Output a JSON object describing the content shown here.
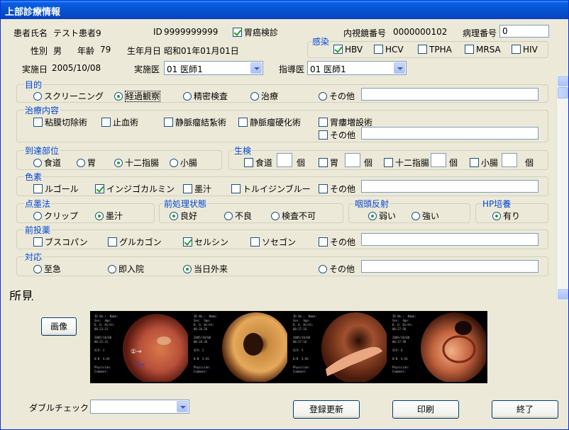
{
  "window": {
    "title": "上部診療情報"
  },
  "header": {
    "patient_name_label": "患者氏名",
    "patient_name": "テスト患者9",
    "id_label": "ID",
    "id_value": "9999999999",
    "gastric_cancer_label": "胃癌検診",
    "gastric_cancer_checked": true,
    "scope_no_label": "内視鏡番号",
    "scope_no": "0000000102",
    "pathology_no_label": "病理番号",
    "pathology_no": "0",
    "sex_label": "性別",
    "sex": "男",
    "age_label": "年齢",
    "age": "79",
    "dob_label": "生年月日",
    "dob": "昭和01年01月01日",
    "date_label": "実施日",
    "date": "2005/10/08",
    "doctor_label": "実施医",
    "doctor": "01 医師1",
    "supervisor_label": "指導医",
    "supervisor": "01 医師1"
  },
  "infection": {
    "title": "感染",
    "items": [
      {
        "label": "HBV",
        "checked": true
      },
      {
        "label": "HCV",
        "checked": false
      },
      {
        "label": "TPHA",
        "checked": false
      },
      {
        "label": "MRSA",
        "checked": false
      },
      {
        "label": "HIV",
        "checked": false
      }
    ]
  },
  "purpose": {
    "title": "目的",
    "options": [
      "スクリーニング",
      "経過観察",
      "精密検査",
      "治療",
      "その他"
    ],
    "selected": "経過観察",
    "other_value": ""
  },
  "treatment": {
    "title": "治療内容",
    "items": [
      {
        "label": "粘膜切除術",
        "checked": false
      },
      {
        "label": "止血術",
        "checked": false
      },
      {
        "label": "静脈瘤結紮術",
        "checked": false
      },
      {
        "label": "静脈瘤硬化術",
        "checked": false
      },
      {
        "label": "胃瘻増設術",
        "checked": false
      },
      {
        "label": "その他",
        "checked": false
      }
    ],
    "other_value": ""
  },
  "reach": {
    "title": "到達部位",
    "options": [
      "食道",
      "胃",
      "十二指腸",
      "小腸"
    ],
    "selected": "十二指腸"
  },
  "biopsy": {
    "title": "生検",
    "unit": "個",
    "items": [
      {
        "label": "食道",
        "checked": false,
        "count": ""
      },
      {
        "label": "胃",
        "checked": false,
        "count": ""
      },
      {
        "label": "十二指腸",
        "checked": false,
        "count": ""
      },
      {
        "label": "小腸",
        "checked": false,
        "count": ""
      }
    ]
  },
  "dye": {
    "title": "色素",
    "items": [
      {
        "label": "ルゴール",
        "checked": false
      },
      {
        "label": "インジゴカルミン",
        "checked": true
      },
      {
        "label": "墨汁",
        "checked": false
      },
      {
        "label": "トルイジンブルー",
        "checked": false
      },
      {
        "label": "その他",
        "checked": false
      }
    ],
    "other_value": ""
  },
  "marking": {
    "title": "点墨法",
    "options": [
      "クリップ",
      "墨汁"
    ],
    "selected": "墨汁"
  },
  "pretreatment": {
    "title": "前処理状態",
    "options": [
      "良好",
      "不良",
      "検査不可"
    ],
    "selected": "良好"
  },
  "pharyngeal": {
    "title": "咽頭反射",
    "options": [
      "弱い",
      "強い"
    ],
    "selected": "弱い"
  },
  "hp": {
    "title": "HP培養",
    "options": [
      "有り"
    ],
    "selected": "有り"
  },
  "premed": {
    "title": "前投薬",
    "items": [
      {
        "label": "ブスコパン",
        "checked": false
      },
      {
        "label": "グルカゴン",
        "checked": false
      },
      {
        "label": "セルシン",
        "checked": true
      },
      {
        "label": "ソセゴン",
        "checked": false
      },
      {
        "label": "その他",
        "checked": false
      }
    ],
    "other_value": ""
  },
  "response": {
    "title": "対応",
    "options": [
      "至急",
      "即入院",
      "当日外来",
      "その他"
    ],
    "selected": "当日外来",
    "other_value": ""
  },
  "findings": {
    "title": "所見"
  },
  "footer": {
    "image_button": "画像",
    "double_check_label": "ダブルチェック",
    "double_check_value": "",
    "register_button": "登録更新",
    "print_button": "印刷",
    "exit_button": "終了"
  },
  "gallery": {
    "images": [
      {
        "caption": "ID No.:  Name:\nSex:  Age:\nD. O. Birth:\n00:23:31\n\n2005/10/08\n00:25:31\n\nSCV: 2\n\n0:N  S:AS\n\nPhysician:\nComment:"
      },
      {
        "caption": "ID No.:  Name:\nSex:  Age:\nD. O. Birth:\n00:26:26\n\n2005/10/08\n00:26:26\n\nSCV: 2\n\n0:N  S:AS\n\nPhysician:\nComment:"
      },
      {
        "caption": "ID No.:  Name:\nSex:  Age:\nD. O. Birth:\n00:27:16\n\n2005/10/08\n00:27:16\n\nSCV: 5\n\n0:N  S:AS\n\nPhysician:\nComment:"
      },
      {
        "caption": "ID No.:  Name:\nSex:  Age:\nD. O. Birth:\n00:27:58\n\n2005/10/08\n00:27:58\n\nSCV: 6\n\n0:N  S:AS\n\nPhysician:\nComment:"
      }
    ],
    "annotation_marks": [
      "①→",
      "I)→"
    ]
  },
  "colors": {
    "group_title": "#0046d5",
    "title_bar": "#0655d4",
    "check_mark": "#21a121"
  }
}
